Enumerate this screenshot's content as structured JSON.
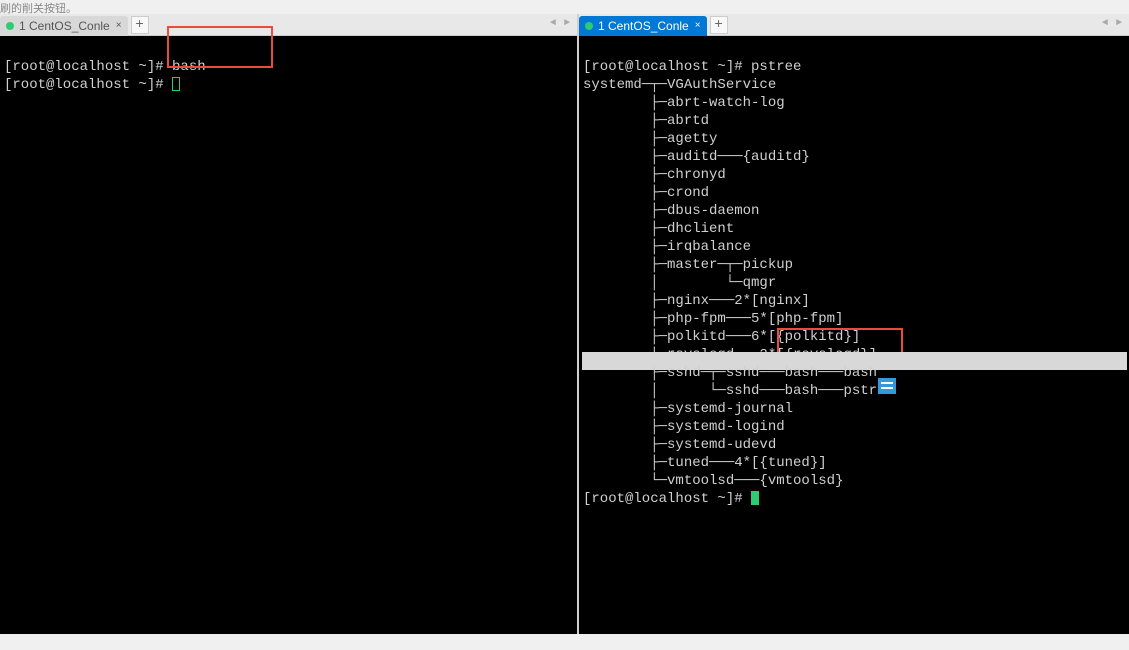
{
  "top_text": "刷的削关按钮。",
  "left_pane": {
    "tab": {
      "dot": "●",
      "label": "1 CentOS_Conle",
      "close": "×"
    },
    "add": "+",
    "nav_left": "◄",
    "nav_right": "►",
    "lines": [
      {
        "prompt": "[root@localhost ~]# ",
        "cmd": "bash"
      },
      {
        "prompt": "[root@localhost ~]# ",
        "cmd": ""
      }
    ]
  },
  "right_pane": {
    "tab": {
      "dot": "●",
      "label": "1 CentOS_Conle",
      "close": "×"
    },
    "add": "+",
    "nav_left": "◄",
    "nav_right": "►",
    "prompt1": "[root@localhost ~]# ",
    "cmd1": "pstree",
    "tree": [
      "systemd─┬─VGAuthService",
      "        ├─abrt-watch-log",
      "        ├─abrtd",
      "        ├─agetty",
      "        ├─auditd───{auditd}",
      "        ├─chronyd",
      "        ├─crond",
      "        ├─dbus-daemon",
      "        ├─dhclient",
      "        ├─irqbalance",
      "        ├─master─┬─pickup",
      "        │        └─qmgr",
      "        ├─nginx───2*[nginx]",
      "        ├─php-fpm───5*[php-fpm]",
      "        ├─polkitd───6*[{polkitd}]",
      "        ├─rsyslogd───2*[{rsyslogd}]",
      "        ├─sshd─┬─sshd───bash───bash",
      "        │      └─sshd───bash───pstree",
      "        ├─systemd-journal",
      "        ├─systemd-logind",
      "        ├─systemd-udevd",
      "        ├─tuned───4*[{tuned}]",
      "        └─vmtoolsd───{vmtoolsd}"
    ],
    "prompt2": "[root@localhost ~]# "
  }
}
